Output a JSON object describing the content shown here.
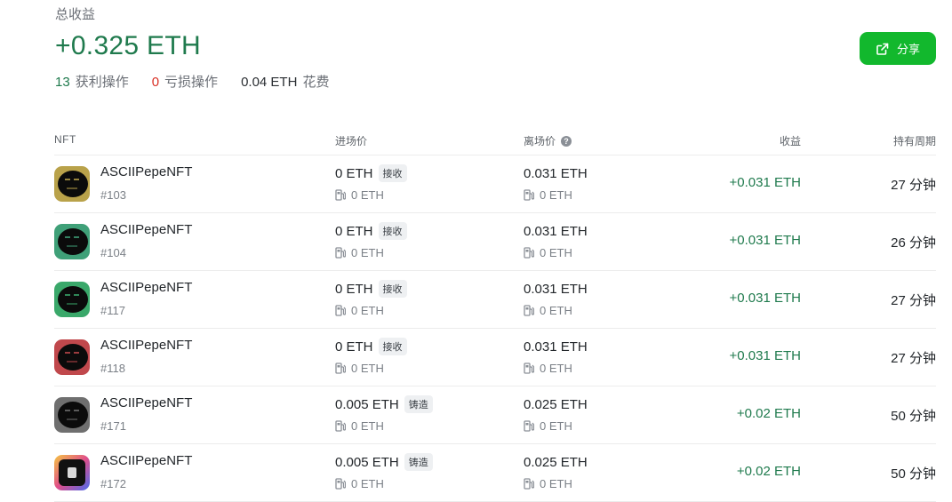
{
  "summary": {
    "label": "总收益",
    "total": "+0.325 ETH",
    "profit_count": "13",
    "profit_label": "获利操作",
    "loss_count": "0",
    "loss_label": "亏损操作",
    "fees_value": "0.04 ETH",
    "fees_label": "花费"
  },
  "share_button": {
    "label": "分享",
    "icon": "external-link-icon"
  },
  "colors": {
    "profit_green": "#1f7a4d",
    "button_green": "#12b82d",
    "loss_red": "#d93025"
  },
  "table": {
    "headers": {
      "nft": "NFT",
      "entry": "进场价",
      "exit": "离场价",
      "profit": "收益",
      "hold": "持有周期"
    },
    "rows": [
      {
        "name": "ASCIIPepeNFT",
        "id": "#103",
        "entry": "0 ETH",
        "entry_tag": "接收",
        "entry_gas": "0 ETH",
        "exit": "0.031 ETH",
        "exit_gas": "0 ETH",
        "profit": "+0.031 ETH",
        "hold": "27 分钟"
      },
      {
        "name": "ASCIIPepeNFT",
        "id": "#104",
        "entry": "0 ETH",
        "entry_tag": "接收",
        "entry_gas": "0 ETH",
        "exit": "0.031 ETH",
        "exit_gas": "0 ETH",
        "profit": "+0.031 ETH",
        "hold": "26 分钟"
      },
      {
        "name": "ASCIIPepeNFT",
        "id": "#117",
        "entry": "0 ETH",
        "entry_tag": "接收",
        "entry_gas": "0 ETH",
        "exit": "0.031 ETH",
        "exit_gas": "0 ETH",
        "profit": "+0.031 ETH",
        "hold": "27 分钟"
      },
      {
        "name": "ASCIIPepeNFT",
        "id": "#118",
        "entry": "0 ETH",
        "entry_tag": "接收",
        "entry_gas": "0 ETH",
        "exit": "0.031 ETH",
        "exit_gas": "0 ETH",
        "profit": "+0.031 ETH",
        "hold": "27 分钟"
      },
      {
        "name": "ASCIIPepeNFT",
        "id": "#171",
        "entry": "0.005 ETH",
        "entry_tag": "铸造",
        "entry_gas": "0 ETH",
        "exit": "0.025 ETH",
        "exit_gas": "0 ETH",
        "profit": "+0.02 ETH",
        "hold": "50 分钟"
      },
      {
        "name": "ASCIIPepeNFT",
        "id": "#172",
        "entry": "0.005 ETH",
        "entry_tag": "铸造",
        "entry_gas": "0 ETH",
        "exit": "0.025 ETH",
        "exit_gas": "0 ETH",
        "profit": "+0.02 ETH",
        "hold": "50 分钟"
      }
    ]
  }
}
